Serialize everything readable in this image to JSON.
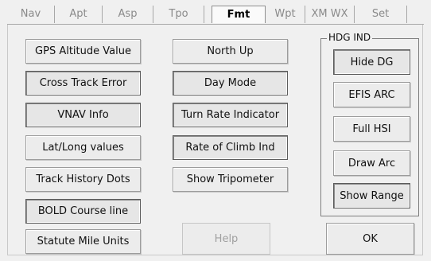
{
  "tabs": [
    {
      "label": "Nav"
    },
    {
      "label": "Apt"
    },
    {
      "label": "Asp"
    },
    {
      "label": "Tpo"
    },
    {
      "label": "Fmt"
    },
    {
      "label": "Wpt"
    },
    {
      "label": "XM WX"
    },
    {
      "label": "Set"
    }
  ],
  "active_tab": "Fmt",
  "left_column": [
    {
      "label": "GPS Altitude Value",
      "pressed": false
    },
    {
      "label": "Cross Track Error",
      "pressed": true
    },
    {
      "label": "VNAV Info",
      "pressed": true
    },
    {
      "label": "Lat/Long values",
      "pressed": false
    },
    {
      "label": "Track History Dots",
      "pressed": false
    },
    {
      "label": "BOLD Course line",
      "pressed": true
    },
    {
      "label": "Statute Mile Units",
      "pressed": false
    }
  ],
  "middle_column": [
    {
      "label": "North Up",
      "pressed": false
    },
    {
      "label": "Day Mode",
      "pressed": true
    },
    {
      "label": "Turn Rate Indicator",
      "pressed": true
    },
    {
      "label": "Rate of Climb Ind",
      "pressed": true
    },
    {
      "label": "Show Tripometer",
      "pressed": false
    }
  ],
  "hdg_group": {
    "label": "HDG IND",
    "buttons": [
      {
        "label": "Hide DG",
        "pressed": true
      },
      {
        "label": "EFIS ARC",
        "pressed": false
      },
      {
        "label": "Full HSI",
        "pressed": false
      },
      {
        "label": "Draw Arc",
        "pressed": false
      },
      {
        "label": "Show Range",
        "pressed": true
      }
    ]
  },
  "footer": {
    "help_label": "Help",
    "ok_label": "OK"
  }
}
